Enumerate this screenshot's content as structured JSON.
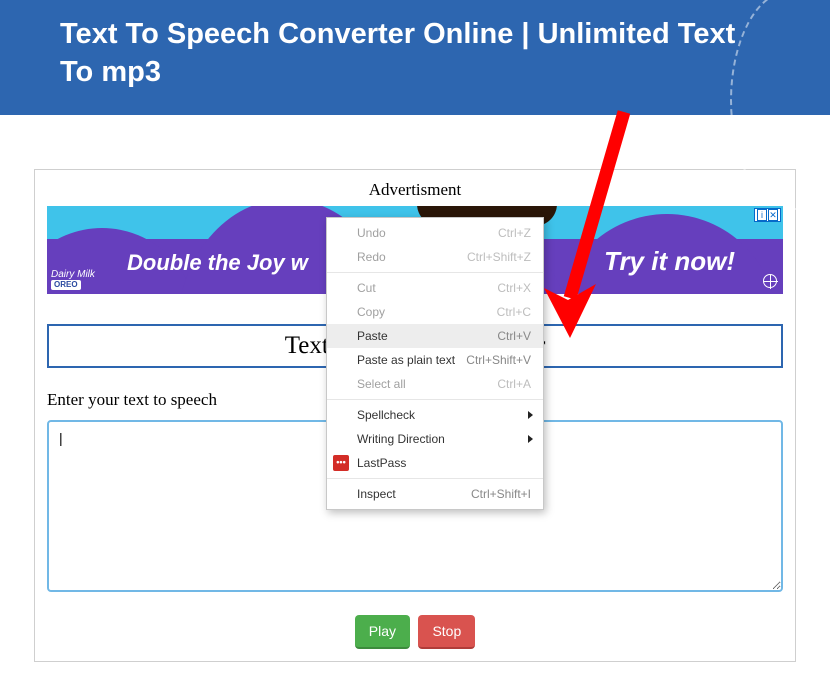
{
  "header": {
    "title": "Text To Speech Converter Online | Unlimited Text To mp3"
  },
  "ad": {
    "label": "Advertisment",
    "left_text": "Double the Joy w",
    "right_text": "Try it now!",
    "brand_top": "Dairy Milk",
    "brand_sub": "OREO",
    "close_info": "i",
    "close_x": "✕"
  },
  "section_title": "Text To Speech Converter",
  "field_label": "Enter your text to speech",
  "textarea_value": "|",
  "buttons": {
    "play": "Play",
    "stop": "Stop"
  },
  "context_menu": {
    "undo": {
      "label": "Undo",
      "shortcut": "Ctrl+Z"
    },
    "redo": {
      "label": "Redo",
      "shortcut": "Ctrl+Shift+Z"
    },
    "cut": {
      "label": "Cut",
      "shortcut": "Ctrl+X"
    },
    "copy": {
      "label": "Copy",
      "shortcut": "Ctrl+C"
    },
    "paste": {
      "label": "Paste",
      "shortcut": "Ctrl+V"
    },
    "paste_plain": {
      "label": "Paste as plain text",
      "shortcut": "Ctrl+Shift+V"
    },
    "select_all": {
      "label": "Select all",
      "shortcut": "Ctrl+A"
    },
    "spellcheck": {
      "label": "Spellcheck"
    },
    "writing_dir": {
      "label": "Writing Direction"
    },
    "lastpass": {
      "label": "LastPass",
      "icon_text": "•••"
    },
    "inspect": {
      "label": "Inspect",
      "shortcut": "Ctrl+Shift+I"
    }
  }
}
